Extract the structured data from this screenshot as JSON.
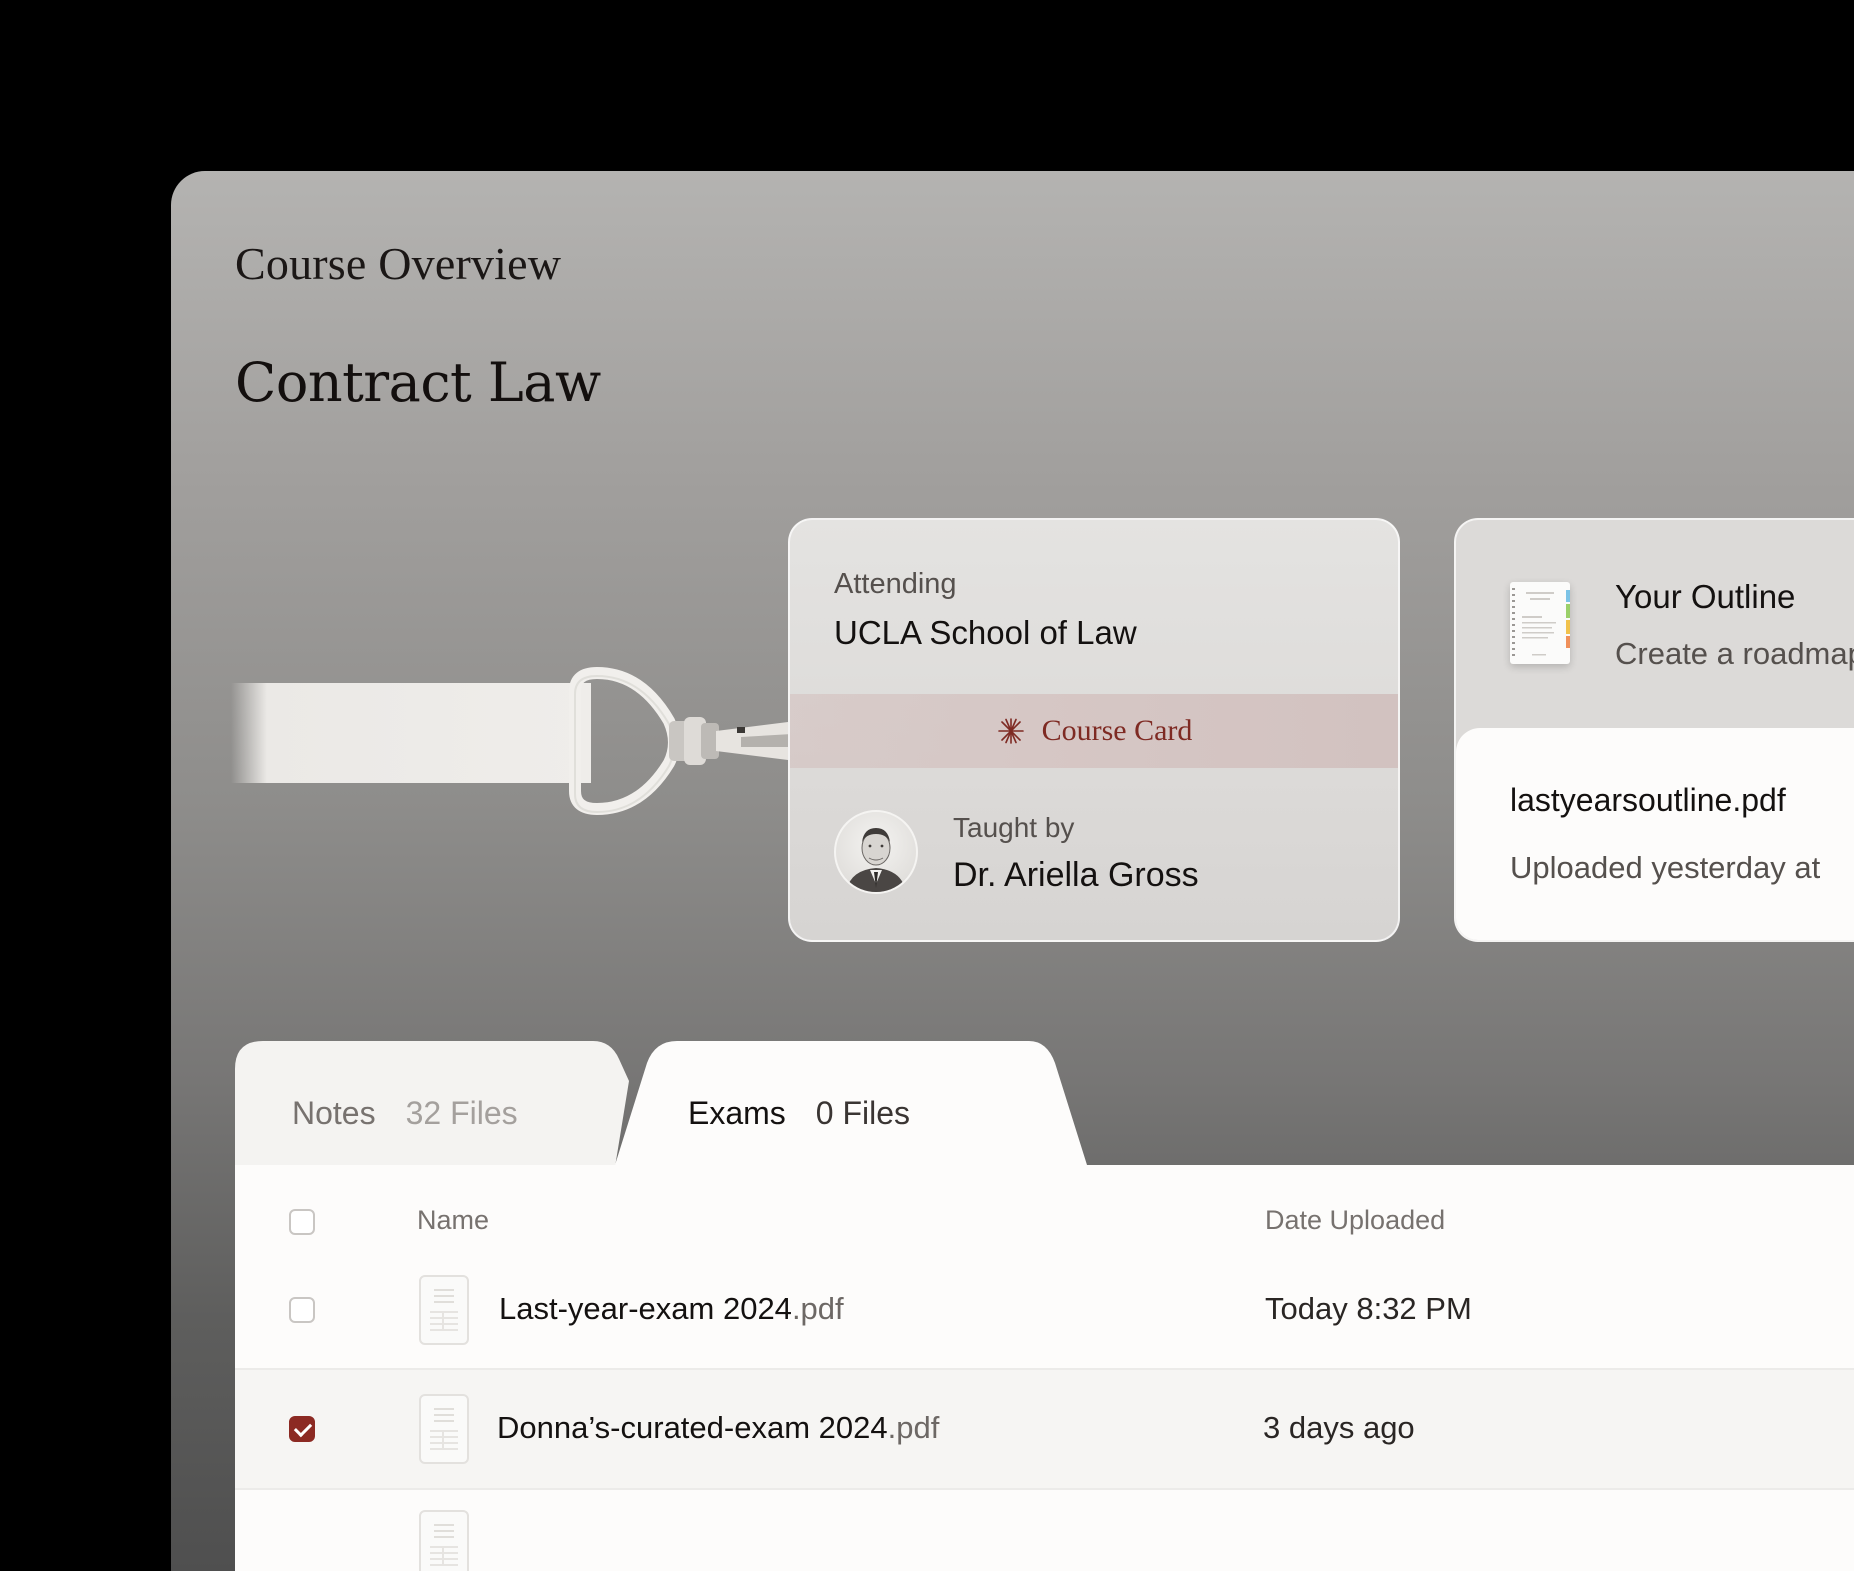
{
  "header": {
    "breadcrumb": "Course Overview",
    "title": "Contract Law"
  },
  "course_card": {
    "attending_label": "Attending",
    "school": "UCLA School of Law",
    "band_label": "Course Card",
    "taught_by_label": "Taught by",
    "instructor": "Dr. Ariella Gross",
    "accent_color": "#7e2a23"
  },
  "outline_card": {
    "title": "Your Outline",
    "subtitle": "Create a roadmap",
    "file": {
      "name": "lastyearsoutline.pdf",
      "meta": "Uploaded yesterday at"
    }
  },
  "tabs": [
    {
      "label": "Notes",
      "count": "32 Files",
      "active": false
    },
    {
      "label": "Exams",
      "count": "0 Files",
      "active": true
    }
  ],
  "table": {
    "columns": {
      "name": "Name",
      "date": "Date Uploaded"
    },
    "rows": [
      {
        "name": "Last-year-exam 2024",
        "ext": ".pdf",
        "date": "Today 8:32 PM",
        "checked": false
      },
      {
        "name": "Donna’s-curated-exam 2024",
        "ext": ".pdf",
        "date": "3 days ago",
        "checked": true
      }
    ]
  },
  "icons": {
    "band": "starburst-icon",
    "doc": "document-icon",
    "outline": "notebook-thumbnail-icon",
    "avatar": "instructor-portrait"
  }
}
